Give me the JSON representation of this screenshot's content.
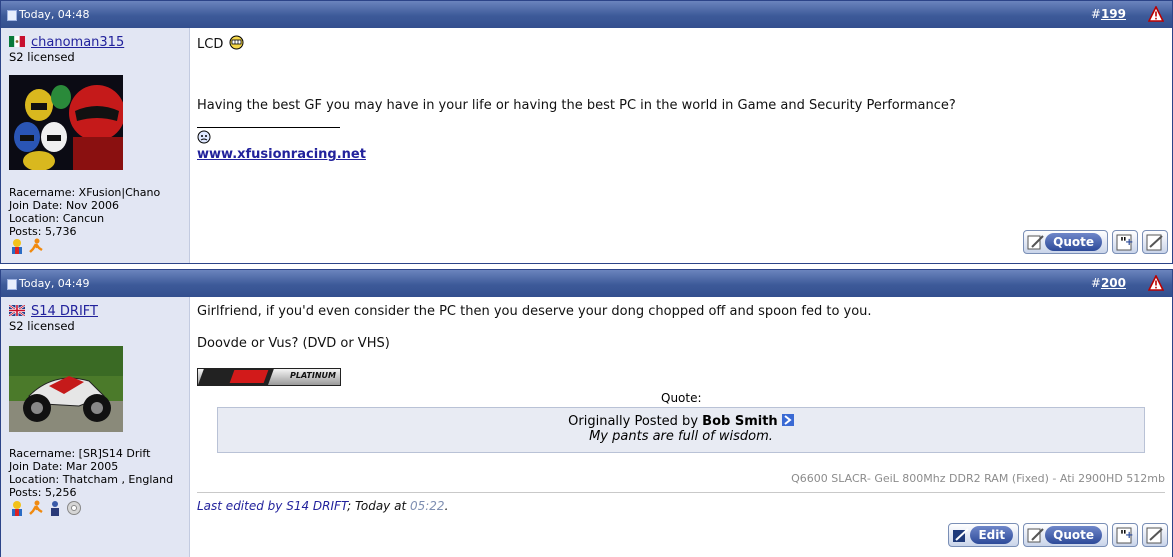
{
  "posts": [
    {
      "date": "Today, 04:48",
      "post_hash": "#",
      "post_number": "199",
      "username": "chanoman315",
      "user_title": "S2 licensed",
      "info": {
        "racername": "Racername: XFusion|Chano",
        "join_date": "Join Date: Nov 2006",
        "location": "Location: Cancun",
        "posts": "Posts: 5,736"
      },
      "body": {
        "line1": "LCD",
        "line2": "Having the best GF you may have in your life or having the best PC in the world in Game and Security Performance?",
        "signature_link": "www.xfusionracing.net"
      },
      "buttons": {
        "quote": "Quote"
      }
    },
    {
      "date": "Today, 04:49",
      "post_hash": "#",
      "post_number": "200",
      "username": "S14 DRIFT",
      "user_title": "S2 licensed",
      "info": {
        "racername": "Racername: [SR]S14 Drift",
        "join_date": "Join Date: Mar 2005",
        "location": "Location: Thatcham , England",
        "posts": "Posts: 5,256"
      },
      "body": {
        "line1": "Girlfriend, if you'd even consider the PC then you deserve your dong chopped off and spoon fed to you.",
        "line2": "Doovde or Vus? (DVD or VHS)",
        "banner_text": "PLATINUM",
        "quote_label": "Quote:",
        "quote_prefix": "Originally Posted by",
        "quote_author": "Bob Smith",
        "quote_text": "My pants are full of wisdom.",
        "signature": "Q6600 SLACR- GeiL 800Mhz DDR2 RAM (Fixed) - Ati 2900HD 512mb",
        "edited_prefix": "Last edited by S14 DRIFT",
        "edited_mid": "; Today at",
        "edited_time": "05:22",
        "edited_end": "."
      },
      "buttons": {
        "edit": "Edit",
        "quote": "Quote"
      }
    }
  ],
  "colors": {
    "header_bg": "#3d5a99",
    "sidebar_bg": "#e2e6f3",
    "link": "#22229c"
  }
}
